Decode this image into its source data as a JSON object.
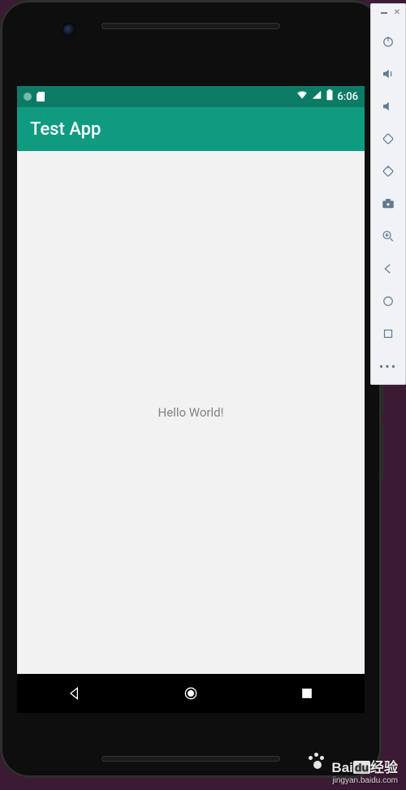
{
  "statusbar": {
    "clock": "6:06"
  },
  "appbar": {
    "title": "Test App"
  },
  "body": {
    "hello": "Hello World!"
  },
  "toolbar": {
    "power": "power-icon",
    "vol_up": "volume-up-icon",
    "vol_down": "volume-down-icon",
    "rotate_left": "rotate-left-icon",
    "rotate_right": "rotate-right-icon",
    "screenshot": "screenshot-icon",
    "zoom": "zoom-icon",
    "back": "back-icon",
    "home": "home-icon",
    "overview": "overview-icon",
    "more": "more-icon"
  },
  "nav": {
    "back": "nav-back-icon",
    "home": "nav-home-icon",
    "overview": "nav-overview-icon"
  },
  "watermark": {
    "line1_a": "Bai",
    "line1_b": "du",
    "line1_c": "经验",
    "line2": "jingyan.baidu.com"
  },
  "colors": {
    "statusbar_bg": "#0c7b66",
    "appbar_bg": "#0f9b80",
    "page_bg": "#3b1a33",
    "body_bg": "#f2f2f2"
  }
}
